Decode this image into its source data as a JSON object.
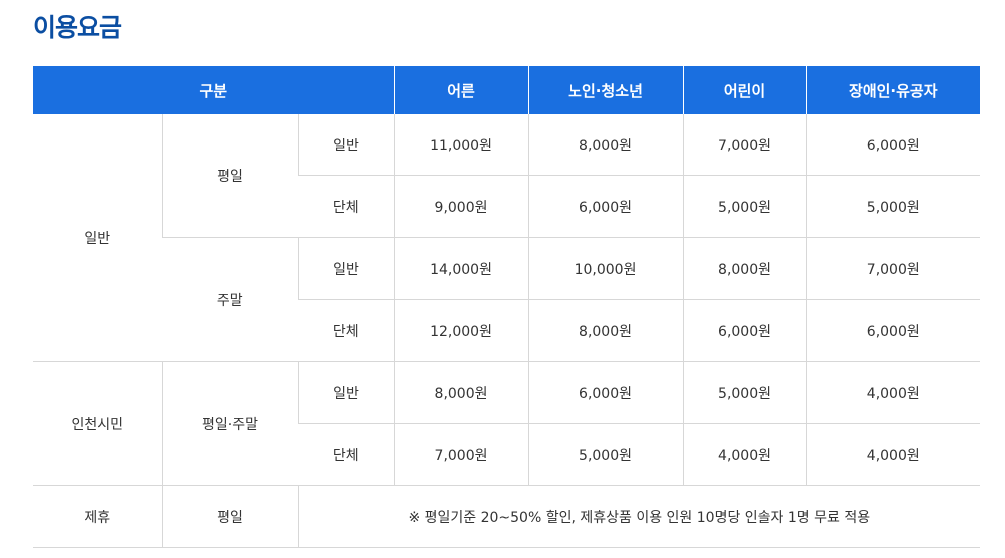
{
  "title": "이용요금",
  "headers": {
    "category": "구분",
    "adult": "어른",
    "senior_youth": "노인·청소년",
    "child": "어린이",
    "disabled_merit": "장애인·유공자"
  },
  "groups": {
    "general": {
      "label": "일반",
      "weekday": {
        "label": "평일",
        "individual": {
          "label": "일반",
          "adult": "11,000원",
          "senior_youth": "8,000원",
          "child": "7,000원",
          "disabled_merit": "6,000원"
        },
        "group": {
          "label": "단체",
          "adult": "9,000원",
          "senior_youth": "6,000원",
          "child": "5,000원",
          "disabled_merit": "5,000원"
        }
      },
      "weekend": {
        "label": "주말",
        "individual": {
          "label": "일반",
          "adult": "14,000원",
          "senior_youth": "10,000원",
          "child": "8,000원",
          "disabled_merit": "7,000원"
        },
        "group": {
          "label": "단체",
          "adult": "12,000원",
          "senior_youth": "8,000원",
          "child": "6,000원",
          "disabled_merit": "6,000원"
        }
      }
    },
    "incheon": {
      "label": "인천시민",
      "all": {
        "label": "평일·주말",
        "individual": {
          "label": "일반",
          "adult": "8,000원",
          "senior_youth": "6,000원",
          "child": "5,000원",
          "disabled_merit": "4,000원"
        },
        "group": {
          "label": "단체",
          "adult": "7,000원",
          "senior_youth": "5,000원",
          "child": "4,000원",
          "disabled_merit": "4,000원"
        }
      }
    },
    "partner": {
      "label": "제휴",
      "day_label": "평일",
      "note": "※ 평일기준 20~50% 할인, 제휴상품 이용 인원 10명당 인솔자 1명 무료 적용"
    }
  }
}
